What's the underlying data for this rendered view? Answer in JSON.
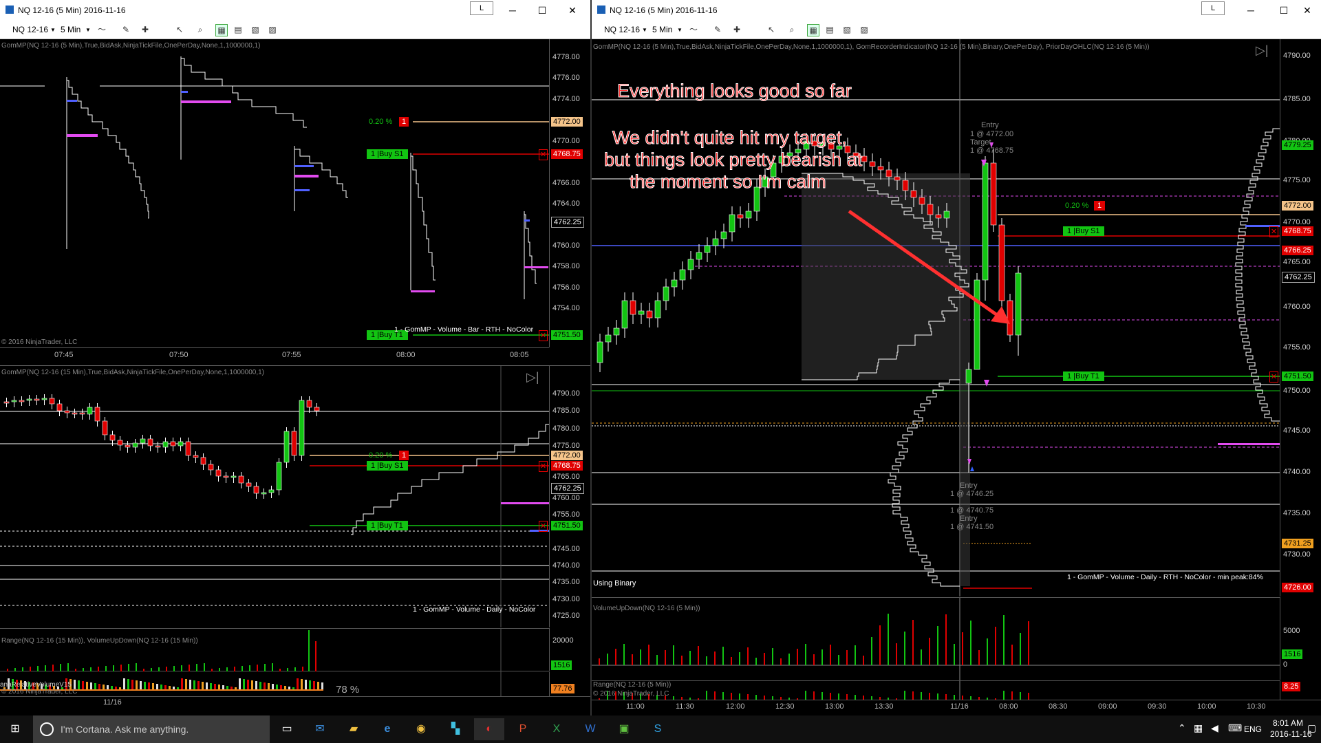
{
  "left_window": {
    "title": "NQ 12-16 (5 Min)  2016-11-16",
    "l_button": "L",
    "toolbar": {
      "instrument": "NQ 12-16",
      "interval": "5 Min"
    },
    "top_chart": {
      "indicator_label": "GomMP(NQ 12-16 (5 Min),True,BidAsk,NinjaTickFile,OnePerDay,None,1,1000000,1)",
      "copyright": "© 2016 NinjaTrader, LLC",
      "legend": "1 - GomMP - Volume - Bar - RTH - NoColor",
      "price_axis": [
        "4778.00",
        "4776.00",
        "4774.00",
        "4772.00",
        "4770.00",
        "4768.00",
        "4766.00",
        "4764.00",
        "4762.00",
        "4760.00",
        "4758.00",
        "4756.00",
        "4754.00",
        "4752.00"
      ],
      "time_axis": [
        "07:45",
        "07:50",
        "07:55",
        "08:00",
        "08:05"
      ],
      "price_tags": [
        {
          "label": "4772.00",
          "color": "#f5c48a",
          "text": "#000"
        },
        {
          "label": "4768.75",
          "color": "#e00000",
          "text": "#fff"
        },
        {
          "label": "4762.25",
          "color": "#000",
          "text": "#fff"
        },
        {
          "label": "4751.50",
          "color": "#12c412",
          "text": "#000"
        }
      ],
      "orders": [
        {
          "pct": "0.20 %",
          "qty": "1"
        },
        {
          "label": "1 |Buy S1"
        },
        {
          "label": "1 |Buy T1"
        }
      ]
    },
    "bottom_chart": {
      "indicator_label": "GomMP(NQ 12-16 (15 Min),True,BidAsk,NinjaTickFile,OnePerDay,None,1,1000000,1)",
      "legend": "1 - GomMP - Volume - Daily - NoColor",
      "price_axis": [
        "4790.00",
        "4785.00",
        "4780.00",
        "4775.00",
        "4770.00",
        "4765.00",
        "4760.00",
        "4755.00",
        "4750.00",
        "4745.00",
        "4740.00",
        "4735.00",
        "4730.00",
        "4725.00"
      ],
      "price_tags": [
        {
          "label": "4772.00",
          "color": "#f5c48a",
          "text": "#000"
        },
        {
          "label": "4768.75",
          "color": "#e00000",
          "text": "#fff"
        },
        {
          "label": "4762.25",
          "color": "#000",
          "text": "#fff"
        },
        {
          "label": "4751.50",
          "color": "#12c412",
          "text": "#000"
        }
      ],
      "orders": [
        {
          "pct": "0.20 %",
          "qty": "1"
        },
        {
          "label": "1 |Buy S1"
        },
        {
          "label": "1 |Buy T1"
        }
      ],
      "range_label": "Range(NQ 12-16 (15 Min)), VolumeUpDown(NQ 12-16 (15 Min))",
      "range_axis": [
        "20000",
        "1516",
        "0"
      ],
      "relvol_label": "anaRelativeVolumeV15",
      "relvol_pct": "78 %",
      "relvol_tag": "77.76",
      "copyright": "© 2016 NinjaTrader, LLC",
      "date_label": "11/16"
    }
  },
  "right_window": {
    "title": "NQ 12-16 (5 Min)  2016-11-16",
    "l_button": "L",
    "toolbar": {
      "instrument": "NQ 12-16",
      "interval": "5 Min"
    },
    "main_chart": {
      "indicator_label": "GomMP(NQ 12-16 (5 Min),True,BidAsk,NinjaTickFile,OnePerDay,None,1,1000000,1), GomRecorderIndicator(NQ 12-16 (5 Min),Binary,OnePerDay), PriorDayOHLC(NQ 12-16 (5 Min))",
      "annotation_1": "Everything looks good so far",
      "annotation_2_lines": [
        "We didn't quite hit my target,",
        "but things look pretty bearish at",
        "the moment so I'm calm"
      ],
      "entry_top": [
        "Entry",
        "1 @ 4772.00",
        "Target",
        "1 @ 4768.75"
      ],
      "entry_bottom": [
        "Entry",
        "1 @ 4746.25",
        "1 @ 4740.75",
        "Entry",
        "1 @ 4741.50"
      ],
      "using_binary": "Using Binary",
      "legend": "1 - GomMP - Volume - Daily - RTH - NoColor - min peak:84%",
      "price_axis": [
        "4790.00",
        "4785.00",
        "4780.00",
        "4775.00",
        "4770.00",
        "4765.00",
        "4760.00",
        "4755.00",
        "4750.00",
        "4745.00",
        "4740.00",
        "4735.00",
        "4730.00"
      ],
      "price_tags": [
        {
          "label": "4779.25",
          "color": "#12c412",
          "text": "#000"
        },
        {
          "label": "4772.00",
          "color": "#f5c48a",
          "text": "#000"
        },
        {
          "label": "4768.75",
          "color": "#e00000",
          "text": "#fff"
        },
        {
          "label": "4766.25",
          "color": "#e00000",
          "text": "#fff"
        },
        {
          "label": "4762.25",
          "color": "#000",
          "text": "#fff"
        },
        {
          "label": "4751.50",
          "color": "#12c412",
          "text": "#000"
        },
        {
          "label": "4731.25",
          "color": "#f0a020",
          "text": "#000"
        },
        {
          "label": "4726.00",
          "color": "#e00000",
          "text": "#fff"
        }
      ],
      "orders": [
        {
          "pct": "0.20 %",
          "qty": "1"
        },
        {
          "label": "1 |Buy S1"
        },
        {
          "label": "1 |Buy T1"
        }
      ]
    },
    "volume_chart": {
      "label": "VolumeUpDown(NQ 12-16 (5 Min))",
      "axis": [
        "5000",
        "1516",
        "0"
      ]
    },
    "range_chart": {
      "label": "Range(NQ 12-16 (5 Min))",
      "copyright": "© 2016 NinjaTrader, LLC",
      "tag": "8.25"
    },
    "time_axis": [
      "11:00",
      "11:30",
      "12:00",
      "12:30",
      "13:00",
      "13:30",
      "11/16",
      "08:00",
      "08:30",
      "09:00",
      "09:30",
      "10:00",
      "10:30"
    ]
  },
  "taskbar": {
    "search_placeholder": "I'm Cortana. Ask me anything.",
    "lang": "ENG",
    "time": "8:01 AM",
    "date": "2016-11-16"
  }
}
